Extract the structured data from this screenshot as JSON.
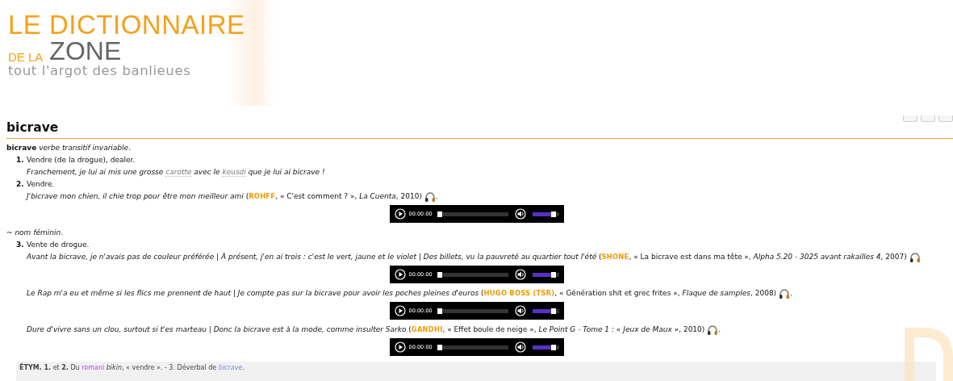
{
  "logo": {
    "title": "LE DICTIONNAIRE",
    "subtitle_small": "DE LA",
    "subtitle_big": "ZONE",
    "tagline": "tout l'argot des banlieues"
  },
  "entry": {
    "title": "bicrave",
    "blocks": [
      {
        "kind": "grammar",
        "text": "**bicrave** *verbe transitif invariable*."
      },
      {
        "kind": "sense",
        "number": "1.",
        "definition": "Vendre (de la drogue), dealer.",
        "examples": [
          {
            "segments": [
              {
                "kind": "text",
                "text": "*Franchement, je lui ai mis une grosse* "
              },
              {
                "kind": "gloss",
                "text": "carotte"
              },
              {
                "kind": "text",
                "text": " *avec le* "
              },
              {
                "kind": "gloss",
                "text": "keusdi"
              },
              {
                "kind": "text",
                "text": " *que je lui ai bicrave !*"
              }
            ]
          }
        ]
      },
      {
        "kind": "sense",
        "number": "2.",
        "definition": "Vendre.",
        "examples": [
          {
            "segments": [
              {
                "kind": "text",
                "text": "*J'bicrave mon chien, il chie trop pour être mon meilleur ami* ("
              },
              {
                "kind": "artist",
                "text": "ROHFF"
              },
              {
                "kind": "text",
                "text": ", « C'est comment ? », *La Cuenta*, 2010) "
              },
              {
                "kind": "audio"
              },
              {
                "kind": "text",
                "text": "."
              }
            ],
            "player": {
              "time": "00:00:00",
              "progress": {
                "level": 0
              },
              "volume": {
                "level": 0.8
              }
            }
          }
        ]
      },
      {
        "kind": "grammar",
        "text": "~ *nom féminin*."
      },
      {
        "kind": "sense",
        "number": "3.",
        "definition": "Vente de drogue.",
        "examples": [
          {
            "segments": [
              {
                "kind": "text",
                "text": "*Avant la bicrave, je n'avais pas de couleur préférée | À présent, j'en ai trois : c'est le vert, jaune et le violet | Des billets, vu la pauvreté au quartier tout l'été* ("
              },
              {
                "kind": "artist",
                "text": "SHONE"
              },
              {
                "kind": "text",
                "text": ", « La bicrave est dans ma tête », *Alpha 5.20 - 3025 avant rakailles 4*, 2007) "
              },
              {
                "kind": "audio"
              }
            ],
            "player": {
              "time": "00:00:00",
              "progress": {
                "level": 0
              },
              "volume": {
                "level": 0.8
              }
            }
          },
          {
            "segments": [
              {
                "kind": "text",
                "text": "*Le Rap m'a eu et même si les flics me prennent de haut | Je compte pas sur la bicrave pour avoir les poches pleines d'euros* ("
              },
              {
                "kind": "artist",
                "text": "HUGO BOSS (TSR)"
              },
              {
                "kind": "text",
                "text": ", « Génération shit et grec frites », *Flaque de samples*, 2008) "
              },
              {
                "kind": "audio"
              },
              {
                "kind": "text",
                "text": "."
              }
            ],
            "player": {
              "time": "00:00:00",
              "progress": {
                "level": 0
              },
              "volume": {
                "level": 0.8
              }
            }
          },
          {
            "segments": [
              {
                "kind": "text",
                "text": "*Dure d'vivre sans un clou, surtout si t'es marteau | Donc la bicrave est à la mode, comme insulter Sarko* ("
              },
              {
                "kind": "artist",
                "text": "GANDHI"
              },
              {
                "kind": "text",
                "text": ", « Effet boule de neige », *Le Point G - Tome 1 : « Jeux de Maux »*, 2010) "
              },
              {
                "kind": "audio"
              },
              {
                "kind": "text",
                "text": "."
              }
            ],
            "player": {
              "time": "00:00:00",
              "progress": {
                "level": 0
              },
              "volume": {
                "level": 0.8
              }
            }
          }
        ]
      }
    ],
    "etymology": [
      {
        "kind": "text",
        "text": "**ÉTYM. 1.** et **2.** Du "
      },
      {
        "kind": "link",
        "text": "romani",
        "visited": true,
        "italic": false
      },
      {
        "kind": "text",
        "text": " *bikin*, « vendre ». - 3. Déverbal de "
      },
      {
        "kind": "link",
        "text": "bicrave",
        "visited": false,
        "italic": true
      },
      {
        "kind": "text",
        "text": "."
      }
    ]
  }
}
